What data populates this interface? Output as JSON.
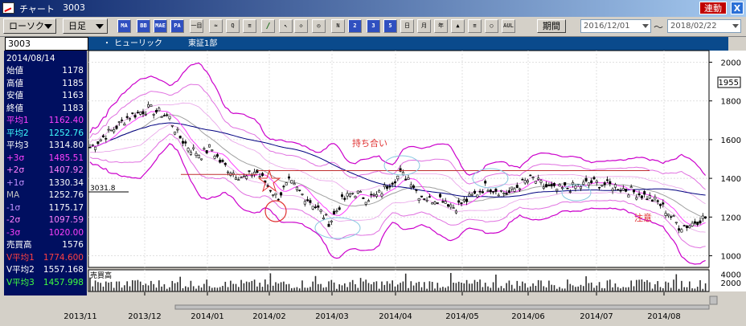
{
  "window": {
    "title": "チャート",
    "code": "3003",
    "link_label": "連動",
    "close_label": "X"
  },
  "toolbar": {
    "mode_label": "ローソク",
    "period_label": "日足",
    "buttons": [
      "MA",
      "BB",
      "MAE",
      "PA",
      "一目",
      "≈",
      "Q",
      "≡",
      "/",
      "↖",
      "◇",
      "◎",
      "N",
      "2",
      "3",
      "5",
      "日",
      "月",
      "年",
      "▲",
      "≡",
      "○",
      "AUL"
    ],
    "kikan_label": "期間",
    "date_from": "2016/12/01",
    "tilde": "～",
    "date_to": "2018/02/22"
  },
  "info": {
    "code": "3003",
    "dot": "・",
    "name": "ヒューリック",
    "market": "東証1部"
  },
  "panel": {
    "date": "2014/08/14",
    "rows": [
      {
        "label": "始値",
        "value": "1178",
        "color": "#ffffff"
      },
      {
        "label": "高値",
        "value": "1185",
        "color": "#ffffff"
      },
      {
        "label": "安値",
        "value": "1163",
        "color": "#ffffff"
      },
      {
        "label": "終値",
        "value": "1183",
        "color": "#ffffff"
      },
      {
        "label": "平均1",
        "value": "1162.40",
        "color": "#ff40ff"
      },
      {
        "label": "平均2",
        "value": "1252.76",
        "color": "#40ffff"
      },
      {
        "label": "平均3",
        "value": "1314.80",
        "color": "#ffffff"
      },
      {
        "label": "+3σ",
        "value": "1485.51",
        "color": "#ff40ff"
      },
      {
        "label": "+2σ",
        "value": "1407.92",
        "color": "#ff80ff"
      },
      {
        "label": "+1σ",
        "value": "1330.34",
        "color": "#c090ff"
      },
      {
        "label": "MA",
        "value": "1252.76",
        "color": "#c0c0c0"
      },
      {
        "label": "-1σ",
        "value": "1175.17",
        "color": "#c090ff"
      },
      {
        "label": "-2σ",
        "value": "1097.59",
        "color": "#ff80ff"
      },
      {
        "label": "-3σ",
        "value": "1020.00",
        "color": "#ff40ff"
      },
      {
        "label": "売買高",
        "value": "1576",
        "color": "#ffffff"
      },
      {
        "label": "V平均1",
        "value": "1774.600",
        "color": "#ff4040"
      },
      {
        "label": "V平均2",
        "value": "1557.168",
        "color": "#ffffff"
      },
      {
        "label": "V平均3",
        "value": "1457.998",
        "color": "#40ff40"
      }
    ]
  },
  "chart": {
    "y_ticks": [
      "2000",
      "1800",
      "1600",
      "1400",
      "1200",
      "1000"
    ],
    "price_tag": "1955",
    "x_ticks": [
      "2013/11",
      "2013/12",
      "2014/01",
      "2014/02",
      "2014/03",
      "2014/04",
      "2014/05",
      "2014/06",
      "2014/07",
      "2014/08"
    ],
    "vol_label": "売買高",
    "vol_ticks": [
      "4000",
      "2000"
    ],
    "level_label": "3031.8",
    "annotations": [
      "持ち合い",
      "注意"
    ],
    "colors": {
      "bg": "#ffffff",
      "band": "#cc00cc",
      "ma": "#000080",
      "candle": "#000000",
      "annot": "#e03030",
      "cloud": "#88c8e0"
    }
  }
}
